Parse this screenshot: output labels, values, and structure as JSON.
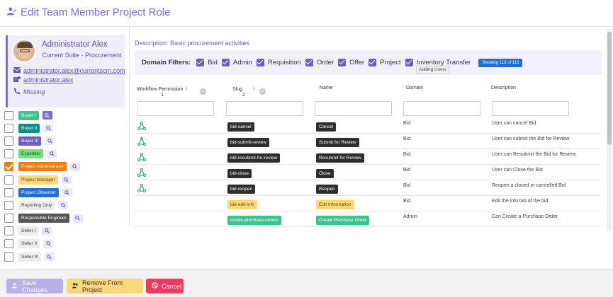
{
  "header": {
    "title": "Edit Team Member Project Role"
  },
  "profile": {
    "name": "Administrator Alex",
    "suite": "Current Suite - Procurement",
    "email": "administrator.alex@currentscm.com",
    "teams": "administrator.alex",
    "phone": "Missing"
  },
  "roles": [
    {
      "label": "Buyer I",
      "bg": "#3cc48e",
      "color": "#ffffff",
      "checked": false,
      "search_dark": true
    },
    {
      "label": "Buyer II",
      "bg": "#138a8a",
      "color": "#ffffff",
      "checked": false,
      "search_dark": false
    },
    {
      "label": "Buyer III",
      "bg": "#6a5ec4",
      "color": "#ffffff",
      "checked": false,
      "search_dark": false
    },
    {
      "label": "Expediter",
      "bg": "#6ee37a",
      "color": "#1f5a25",
      "checked": false,
      "search_dark": false
    },
    {
      "label": "Project Administrator",
      "bg": "#f07c12",
      "color": "#ffffff",
      "checked": true,
      "search_dark": false
    },
    {
      "label": "Project Manager",
      "bg": "#ffd777",
      "color": "#5a4a18",
      "checked": false,
      "search_dark": false
    },
    {
      "label": "Project Observer",
      "bg": "#1f6fd6",
      "color": "#ffffff",
      "checked": false,
      "search_dark": false
    },
    {
      "label": "Reporting Only",
      "bg": "#ececec",
      "color": "#444444",
      "checked": false,
      "search_dark": false
    },
    {
      "label": "Responsible Engineer",
      "bg": "#555555",
      "color": "#ffffff",
      "checked": false,
      "search_dark": false
    },
    {
      "label": "Seller I",
      "bg": "#ececec",
      "color": "#444444",
      "checked": false,
      "search_dark": false
    },
    {
      "label": "Seller II",
      "bg": "#ececec",
      "color": "#444444",
      "checked": false,
      "search_dark": false
    },
    {
      "label": "Seller III",
      "bg": "#ececec",
      "color": "#444444",
      "checked": false,
      "search_dark": false
    }
  ],
  "main": {
    "description": "Description: Basic procurement activities",
    "filters_label": "Domain Filters:",
    "filters": [
      "Bid",
      "Admin",
      "Requisition",
      "Order",
      "Offer",
      "Project",
      "Inventory Transfer"
    ],
    "showing": "Showing 113 of 113",
    "tooltip": "Adding Users"
  },
  "table": {
    "headers": {
      "workflow": "Workflow Permission",
      "workflow_sort": "1",
      "slug": "Slug",
      "slug_sort": "2",
      "name": "Name",
      "domain": "Domain",
      "description": "Description"
    },
    "rows": [
      {
        "workflow": true,
        "slug": "bid-cancel",
        "name": "Cancel",
        "domain": "Bid",
        "description": "User can cancel Bid",
        "style": "dark"
      },
      {
        "workflow": true,
        "slug": "bid-submit-review",
        "name": "Submit for Review",
        "domain": "Bid",
        "description": "User can submit the Bid for Review",
        "style": "dark"
      },
      {
        "workflow": true,
        "slug": "bid-resubmit-for-review",
        "name": "Resubmit for Review",
        "domain": "Bid",
        "description": "User can Resubmit the Bid for Review",
        "style": "dark"
      },
      {
        "workflow": true,
        "slug": "bid-close",
        "name": "Close",
        "domain": "Bid",
        "description": "User can Close the Bid",
        "style": "dark"
      },
      {
        "workflow": true,
        "slug": "bid-reopen",
        "name": "Reopen",
        "domain": "Bid",
        "description": "Reopen a closed or cancelled Bid",
        "style": "dark"
      },
      {
        "workflow": false,
        "slug": "bid-edit-info",
        "name": "Edit Information",
        "domain": "Bid",
        "description": "Edit the info tab of the bid",
        "style": "yel"
      },
      {
        "workflow": false,
        "slug": "create-purchase-orders",
        "name": "Create Purchase Order",
        "domain": "Admin",
        "description": "Can Create a Purchase Order",
        "style": "grn"
      }
    ]
  },
  "footer": {
    "save": "Save Changes",
    "remove": "Remove From Project",
    "cancel": "Cancel"
  },
  "colors": {
    "accent": "#6a5ec4",
    "warning": "#ffd777",
    "danger": "#ef3b62",
    "info": "#1f6fd6"
  }
}
